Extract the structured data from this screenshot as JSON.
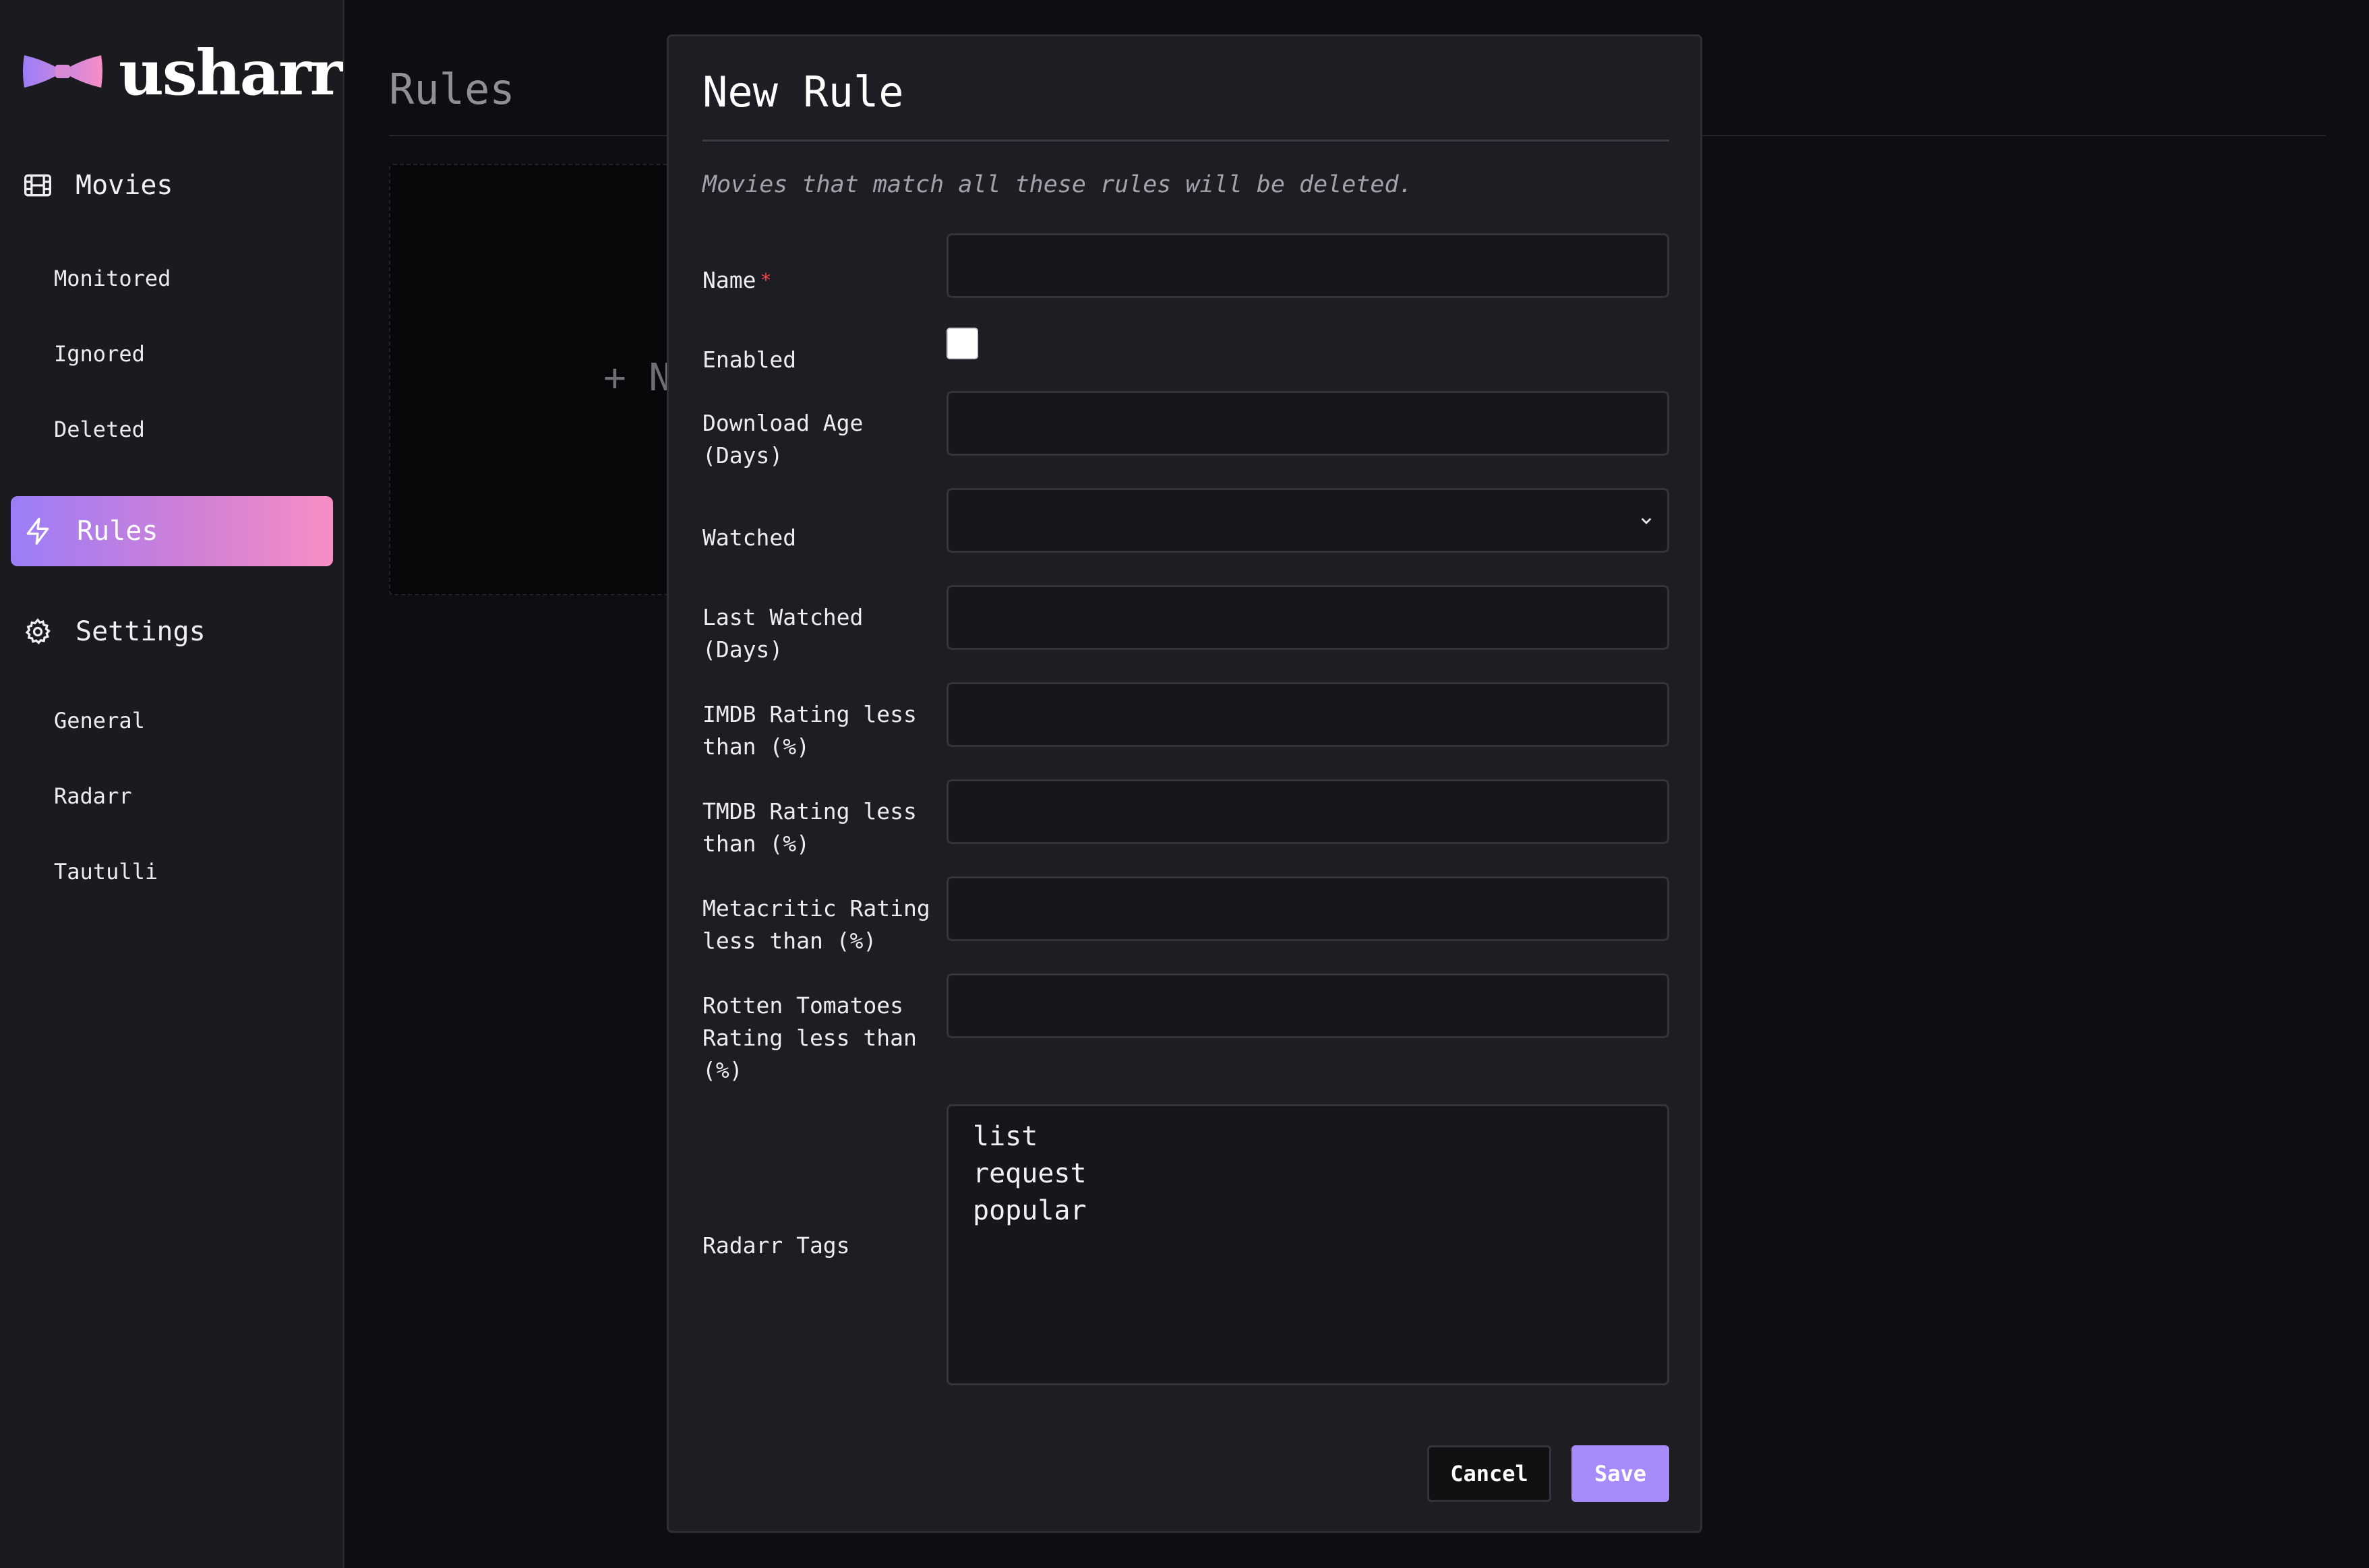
{
  "app": {
    "name": "usharr",
    "logo_icon": "bowtie-logo"
  },
  "sidebar": {
    "sections": [
      {
        "label": "Movies",
        "icon": "film-icon",
        "items": [
          "Monitored",
          "Ignored",
          "Deleted"
        ]
      },
      {
        "label": "Rules",
        "icon": "lightning-icon",
        "active": true
      },
      {
        "label": "Settings",
        "icon": "gear-icon",
        "items": [
          "General",
          "Radarr",
          "Tautulli"
        ]
      }
    ]
  },
  "main": {
    "title": "Rules",
    "new_card_label": "+ New Rule"
  },
  "modal": {
    "title": "New Rule",
    "description": "Movies that match all these rules will be deleted.",
    "fields": {
      "name": {
        "label": "Name",
        "required_mark": "*",
        "value": ""
      },
      "enabled": {
        "label": "Enabled",
        "checked": false
      },
      "download_age": {
        "label": "Download Age (Days)",
        "value": ""
      },
      "watched": {
        "label": "Watched",
        "selected": ""
      },
      "last_watched": {
        "label": "Last Watched (Days)",
        "value": ""
      },
      "imdb": {
        "label": "IMDB Rating less than (%)",
        "value": ""
      },
      "tmdb": {
        "label": "TMDB Rating less than (%)",
        "value": ""
      },
      "metacritic": {
        "label": "Metacritic Rating less than (%)",
        "value": ""
      },
      "rotten_tomatoes": {
        "label": "Rotten Tomatoes Rating less than (%)",
        "value": ""
      },
      "radarr_tags": {
        "label": "Radarr Tags",
        "options": [
          "list",
          "request",
          "popular"
        ]
      }
    },
    "buttons": {
      "cancel": "Cancel",
      "save": "Save"
    }
  },
  "colors": {
    "accent": "#a78bfa",
    "gradient_start": "#9b7ef8",
    "gradient_end": "#f78ec5",
    "required": "#ef4444"
  }
}
